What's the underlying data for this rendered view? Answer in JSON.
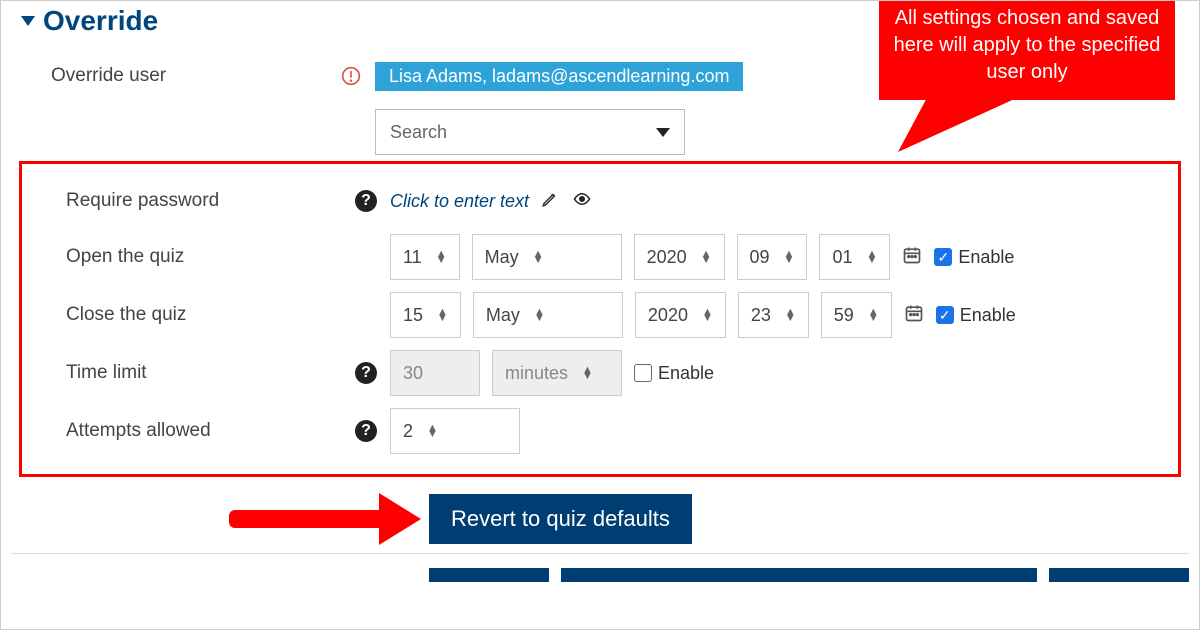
{
  "section": {
    "title": "Override"
  },
  "callout": {
    "text": "All settings chosen and saved here will apply to the specified user only"
  },
  "override_user": {
    "label": "Override user",
    "selected": "Lisa Adams, ladams@ascendlearning.com",
    "search_placeholder": "Search"
  },
  "password": {
    "label": "Require password",
    "placeholder": "Click to enter text"
  },
  "open": {
    "label": "Open the quiz",
    "day": "11",
    "month": "May",
    "year": "2020",
    "hour": "09",
    "minute": "01",
    "enable_label": "Enable",
    "enabled": true
  },
  "close": {
    "label": "Close the quiz",
    "day": "15",
    "month": "May",
    "year": "2020",
    "hour": "23",
    "minute": "59",
    "enable_label": "Enable",
    "enabled": true
  },
  "timelimit": {
    "label": "Time limit",
    "value": "30",
    "unit": "minutes",
    "enable_label": "Enable",
    "enabled": false
  },
  "attempts": {
    "label": "Attempts allowed",
    "value": "2"
  },
  "buttons": {
    "revert": "Revert to quiz defaults"
  }
}
